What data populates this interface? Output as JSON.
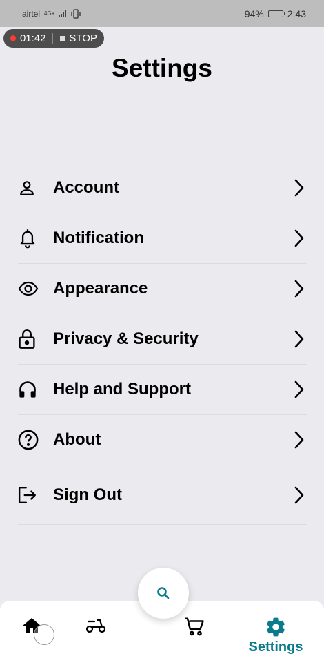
{
  "status_bar": {
    "carrier": "airtel",
    "network_tag": "4G+",
    "battery_percent": "94%",
    "battery_level": 0.94,
    "time": "2:43"
  },
  "recording": {
    "elapsed": "01:42",
    "stop_label": "STOP"
  },
  "page": {
    "title": "Settings"
  },
  "menu": {
    "items": [
      {
        "label": "Account",
        "icon": "person-icon"
      },
      {
        "label": "Notification",
        "icon": "bell-icon"
      },
      {
        "label": "Appearance",
        "icon": "eye-icon"
      },
      {
        "label": "Privacy & Security",
        "icon": "lock-icon"
      },
      {
        "label": "Help and Support",
        "icon": "headphones-icon"
      },
      {
        "label": "About",
        "icon": "help-circle-icon"
      },
      {
        "label": "Sign Out",
        "icon": "logout-icon"
      }
    ]
  },
  "bottom_nav": {
    "items": [
      {
        "icon": "home-icon"
      },
      {
        "icon": "scooter-icon"
      },
      {
        "icon": "cart-icon"
      },
      {
        "icon": "gear-icon",
        "label": "Settings",
        "active": true
      }
    ],
    "fab_icon": "search-icon"
  },
  "colors": {
    "accent": "#0a7b8c",
    "background": "#ebeaef",
    "status_bar": "#bdbdbd",
    "record_dot": "#ff3b2f"
  }
}
